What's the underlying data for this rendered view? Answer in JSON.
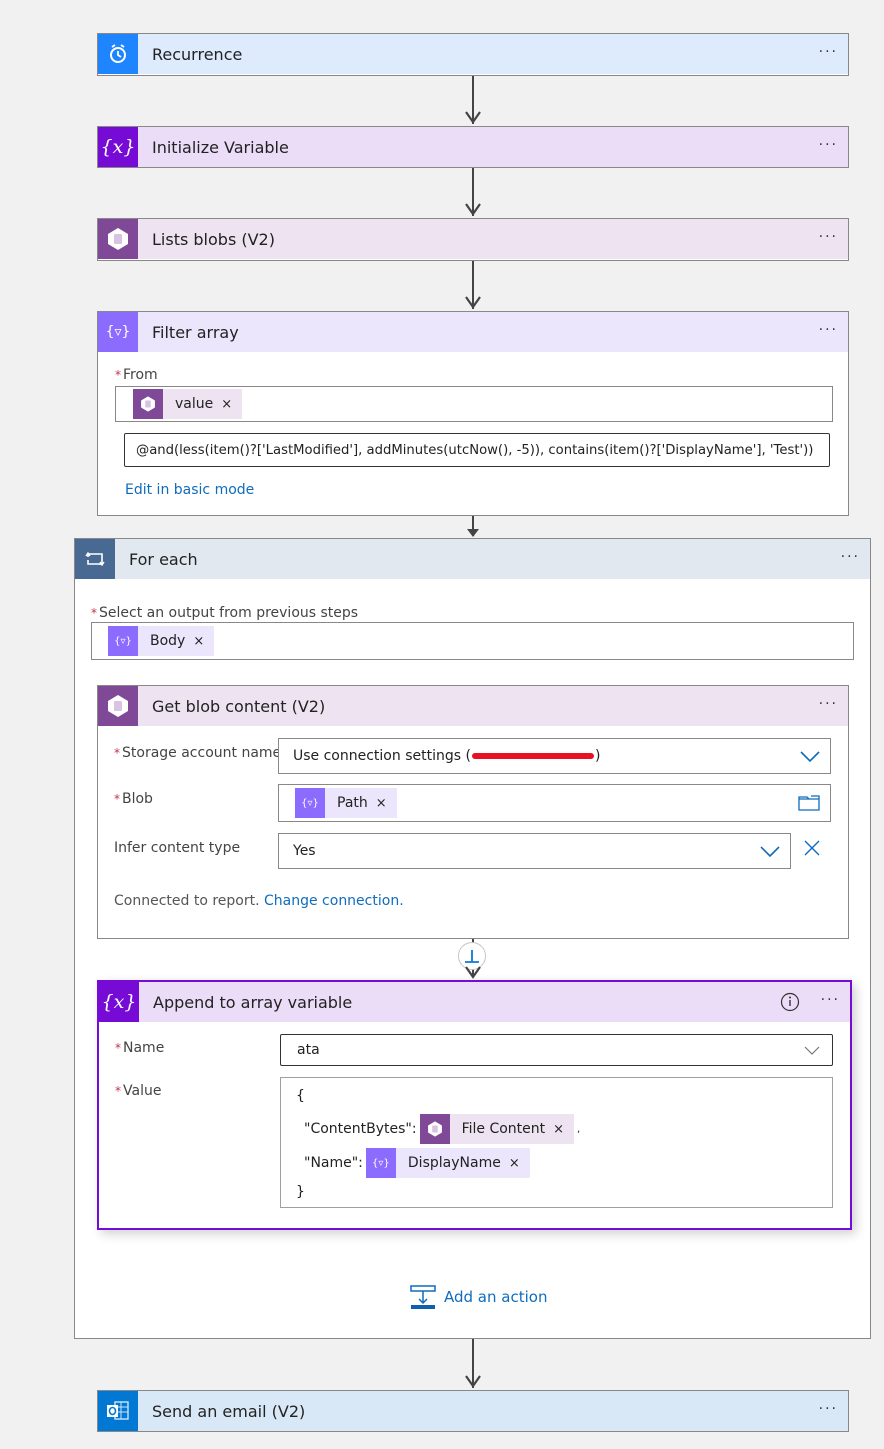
{
  "colors": {
    "trigger_blue": "#1f85ff",
    "variable_purple": "#770bd6",
    "blob_purple": "#804998",
    "filter_violet": "#8c6cff",
    "foreach_slate": "#486991",
    "outlook_blue": "#0078d4",
    "link_blue": "#0f6cbd",
    "required_red": "#c4314b"
  },
  "steps": {
    "recurrence": {
      "title": "Recurrence",
      "icon": "alarm-clock-icon",
      "more": "···"
    },
    "init_variable": {
      "title": "Initialize Variable",
      "icon": "variable-icon",
      "more": "···"
    },
    "list_blobs": {
      "title": "Lists blobs (V2)",
      "icon": "blob-storage-icon",
      "more": "···"
    },
    "filter_array": {
      "title": "Filter array",
      "icon": "filter-icon",
      "more": "···",
      "from_label": "From",
      "from_token": "value",
      "expression": "@and(less(item()?['LastModified'], addMinutes(utcNow(), -5)), contains(item()?['DisplayName'], 'Test'))",
      "edit_mode_link": "Edit in basic mode"
    },
    "for_each": {
      "title": "For each",
      "icon": "loop-icon",
      "more": "···",
      "select_label": "Select an output from previous steps",
      "select_token": "Body",
      "add_action": "Add an action"
    },
    "get_blob": {
      "title": "Get blob content (V2)",
      "icon": "blob-storage-icon",
      "more": "···",
      "storage_label": "Storage account name",
      "storage_value_prefix": "Use connection settings (",
      "storage_value_suffix": ")",
      "blob_label": "Blob",
      "blob_token": "Path",
      "infer_label": "Infer content type",
      "infer_value": "Yes",
      "connected_text": "Connected to report.",
      "change_connection": "Change connection."
    },
    "append_array": {
      "title": "Append to array variable",
      "icon": "variable-icon",
      "more": "···",
      "name_label": "Name",
      "name_value": "ata",
      "value_label": "Value",
      "value_open": "{",
      "content_bytes_key": "\"ContentBytes\":",
      "content_bytes_token": "File Content",
      "name_key": "\"Name\":",
      "name_token": "DisplayName",
      "value_close": "}",
      "comma": ","
    },
    "send_email": {
      "title": "Send an email (V2)",
      "icon": "outlook-icon",
      "more": "···"
    }
  },
  "token_remove_glyph": "×"
}
